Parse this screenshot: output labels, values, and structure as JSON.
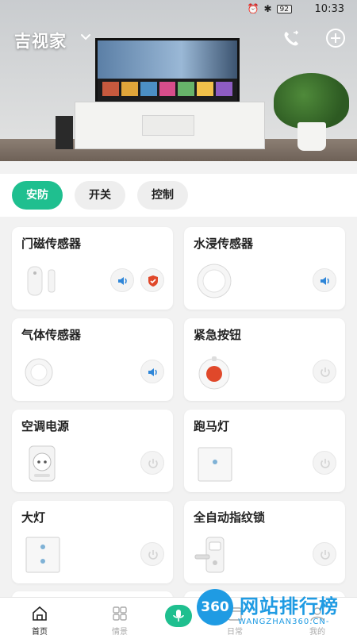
{
  "status_bar": {
    "battery": "92",
    "time": "10:33"
  },
  "header": {
    "title": "吉视家"
  },
  "tabs": [
    {
      "label": "安防",
      "active": true
    },
    {
      "label": "开关",
      "active": false
    },
    {
      "label": "控制",
      "active": false
    }
  ],
  "devices": [
    {
      "name": "门磁传感器",
      "device_icon": "door-sensor-icon",
      "actions": [
        "sound-icon",
        "shield-icon"
      ]
    },
    {
      "name": "水浸传感器",
      "device_icon": "water-sensor-icon",
      "actions": [
        "sound-icon"
      ]
    },
    {
      "name": "气体传感器",
      "device_icon": "gas-sensor-icon",
      "actions": [
        "sound-icon"
      ]
    },
    {
      "name": "紧急按钮",
      "device_icon": "emergency-button-icon",
      "actions": [
        "power-icon"
      ]
    },
    {
      "name": "空调电源",
      "device_icon": "ac-plug-icon",
      "actions": [
        "power-icon"
      ]
    },
    {
      "name": "跑马灯",
      "device_icon": "marquee-light-switch-icon",
      "actions": [
        "power-icon"
      ]
    },
    {
      "name": "大灯",
      "device_icon": "main-light-switch-icon",
      "actions": [
        "power-icon"
      ]
    },
    {
      "name": "全自动指纹锁",
      "device_icon": "fingerprint-lock-icon",
      "actions": [
        "power-icon"
      ]
    }
  ],
  "bottom_nav": [
    {
      "label": "首页",
      "icon": "home-icon"
    },
    {
      "label": "情景",
      "icon": "grid-icon"
    },
    {
      "label": "日常",
      "icon": "calendar-icon"
    },
    {
      "label": "我的",
      "icon": "user-icon"
    }
  ],
  "watermark": {
    "logo": "360",
    "title": "网站排行榜",
    "url": "WANGZHAN360.CN-"
  },
  "colors": {
    "accent": "#1fbf8f",
    "sound_blue": "#2f86d8",
    "alert_red": "#e0482a"
  }
}
